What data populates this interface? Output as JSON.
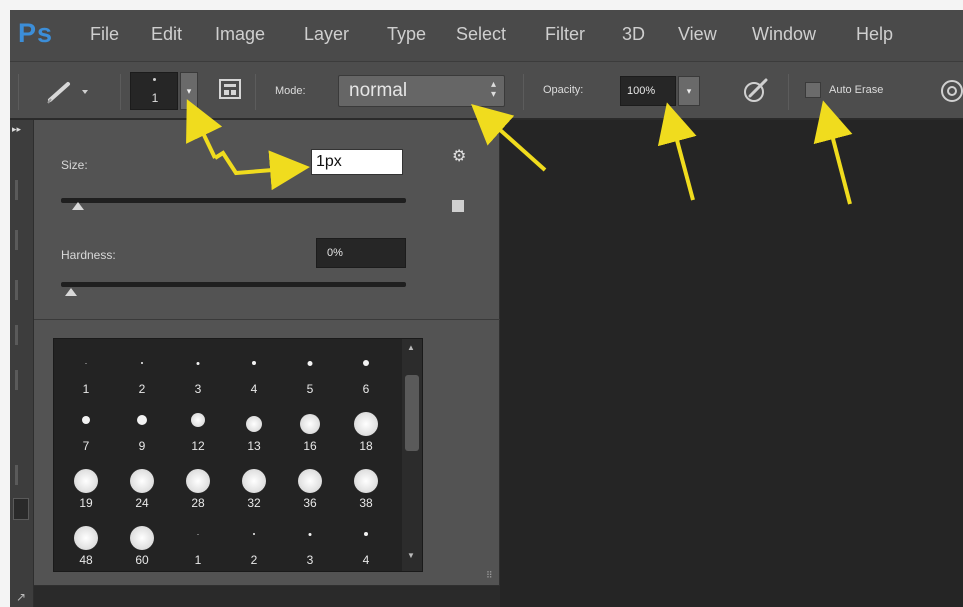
{
  "app": {
    "logo": "Ps"
  },
  "menu": [
    "File",
    "Edit",
    "Image",
    "Layer",
    "Type",
    "Select",
    "Filter",
    "3D",
    "View",
    "Window",
    "Help"
  ],
  "options_bar": {
    "brush_size": "1",
    "mode_label": "Mode:",
    "mode_value": "normal",
    "opacity_label": "Opacity:",
    "opacity_value": "100%",
    "auto_erase_label": "Auto Erase",
    "auto_erase_checked": false
  },
  "brush_panel": {
    "size_label": "Size:",
    "size_value": "1px",
    "size_slider_value": 0.02,
    "hardness_label": "Hardness:",
    "hardness_value": "0%",
    "hardness_slider_value": 0.0,
    "presets": [
      "1",
      "2",
      "3",
      "4",
      "5",
      "6",
      "7",
      "9",
      "12",
      "13",
      "16",
      "18",
      "19",
      "24",
      "28",
      "32",
      "36",
      "38",
      "48",
      "60",
      "1",
      "2",
      "3",
      "4"
    ]
  },
  "colors": {
    "annotation_arrow": "#f0dc1e",
    "ps_blue": "#3c8ed8"
  }
}
